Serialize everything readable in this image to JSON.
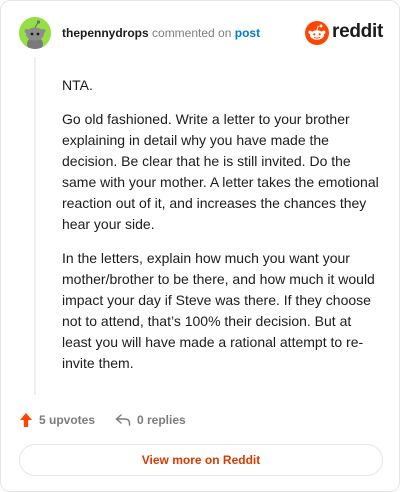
{
  "header": {
    "username": "thepennydrops",
    "action_text": "commented on",
    "post_link": "post",
    "brand": "reddit"
  },
  "comment": {
    "paragraphs": [
      "NTA.",
      "Go old fashioned. Write a letter to your brother explaining in detail why you have made the decision. Be clear that he is still invited. Do the same with your mother. A letter takes the emotional reaction out of it, and increases the chances they hear your side.",
      "In the letters, explain how much you want your mother/brother to be there, and how much it would impact your day if Steve was there. If they choose not to attend, that’s 100% their decision. But at least you will have made a rational attempt to re-invite them."
    ]
  },
  "actions": {
    "upvotes": "5 upvotes",
    "replies": "0 replies"
  },
  "footer": {
    "view_more": "View more on Reddit"
  },
  "colors": {
    "accent_orange": "#ff4500",
    "link_blue": "#0079d3",
    "view_more_text": "#d93a00",
    "avatar_green": "#94e044"
  }
}
